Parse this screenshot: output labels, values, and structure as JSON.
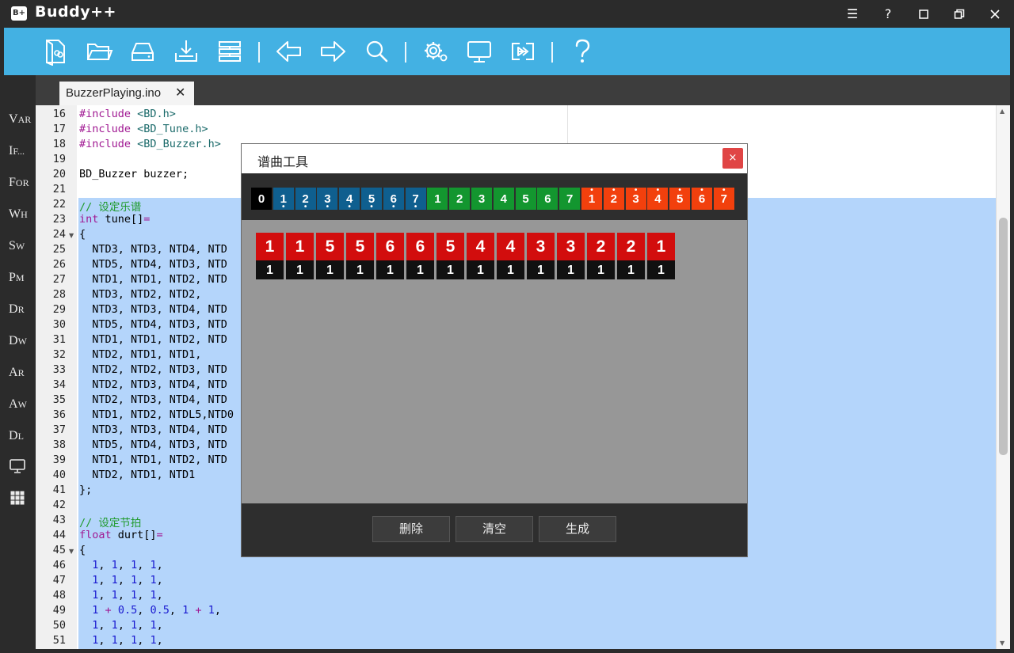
{
  "app": {
    "logo": "B+",
    "title": "Buddy++",
    "window_controls": [
      "☰",
      "?",
      "restore",
      "maximize",
      "close"
    ]
  },
  "toolbar": {
    "icons": [
      "new-file-icon",
      "open-folder-icon",
      "drive-icon",
      "download-icon",
      "stack-icon",
      "back-arrow-icon",
      "forward-arrow-icon",
      "search-icon",
      "settings-icon",
      "monitor-icon",
      "upload-icon",
      "help-icon"
    ]
  },
  "tabs": [
    {
      "label": "BuzzerPlaying.ino",
      "close": "✕"
    }
  ],
  "sidebar": {
    "items": [
      {
        "big": "V",
        "small": "AR"
      },
      {
        "big": "I",
        "small": "F..."
      },
      {
        "big": "F",
        "small": "OR"
      },
      {
        "big": "W",
        "small": "H"
      },
      {
        "big": "S",
        "small": "W"
      },
      {
        "big": "P",
        "small": "M"
      },
      {
        "big": "D",
        "small": "R"
      },
      {
        "big": "D",
        "small": "W"
      },
      {
        "big": "A",
        "small": "R"
      },
      {
        "big": "A",
        "small": "W"
      },
      {
        "big": "D",
        "small": "L"
      }
    ],
    "icons": [
      "monitor-icon",
      "grid-icon"
    ]
  },
  "editor": {
    "lines": [
      {
        "n": "16",
        "text": "#include <BD.h>"
      },
      {
        "n": "17",
        "text": "#include <BD_Tune.h>"
      },
      {
        "n": "18",
        "text": "#include <BD_Buzzer.h>"
      },
      {
        "n": "19",
        "text": ""
      },
      {
        "n": "20",
        "text": "BD_Buzzer buzzer;"
      },
      {
        "n": "21",
        "text": ""
      },
      {
        "n": "22",
        "text": "// 设定乐谱"
      },
      {
        "n": "23",
        "text": "int tune[]="
      },
      {
        "n": "24",
        "text": "{"
      },
      {
        "n": "25",
        "text": "  NTD3, NTD3, NTD4, NTD"
      },
      {
        "n": "26",
        "text": "  NTD5, NTD4, NTD3, NTD"
      },
      {
        "n": "27",
        "text": "  NTD1, NTD1, NTD2, NTD"
      },
      {
        "n": "28",
        "text": "  NTD3, NTD2, NTD2,"
      },
      {
        "n": "29",
        "text": "  NTD3, NTD3, NTD4, NTD"
      },
      {
        "n": "30",
        "text": "  NTD5, NTD4, NTD3, NTD"
      },
      {
        "n": "31",
        "text": "  NTD1, NTD1, NTD2, NTD"
      },
      {
        "n": "32",
        "text": "  NTD2, NTD1, NTD1,"
      },
      {
        "n": "33",
        "text": "  NTD2, NTD2, NTD3, NTD"
      },
      {
        "n": "34",
        "text": "  NTD2, NTD3, NTD4, NTD"
      },
      {
        "n": "35",
        "text": "  NTD2, NTD3, NTD4, NTD"
      },
      {
        "n": "36",
        "text": "  NTD1, NTD2, NTDL5,NTD0"
      },
      {
        "n": "37",
        "text": "  NTD3, NTD3, NTD4, NTD"
      },
      {
        "n": "38",
        "text": "  NTD5, NTD4, NTD3, NTD"
      },
      {
        "n": "39",
        "text": "  NTD1, NTD1, NTD2, NTD"
      },
      {
        "n": "40",
        "text": "  NTD2, NTD1, NTD1"
      },
      {
        "n": "41",
        "text": "};"
      },
      {
        "n": "42",
        "text": ""
      },
      {
        "n": "43",
        "text": "// 设定节拍"
      },
      {
        "n": "44",
        "text": "float durt[]="
      },
      {
        "n": "45",
        "text": "{"
      },
      {
        "n": "46",
        "text": "  1, 1, 1, 1,"
      },
      {
        "n": "47",
        "text": "  1, 1, 1, 1,"
      },
      {
        "n": "48",
        "text": "  1, 1, 1, 1,"
      },
      {
        "n": "49",
        "text": "  1 + 0.5, 0.5, 1 + 1,"
      },
      {
        "n": "50",
        "text": "  1, 1, 1, 1,"
      },
      {
        "n": "51",
        "text": "  1, 1, 1, 1,"
      }
    ]
  },
  "dialog": {
    "title": "谱曲工具",
    "close": "×",
    "palette": [
      {
        "digit": "0",
        "octave": "rest",
        "color": "#000000"
      },
      {
        "digit": "1",
        "octave": "low",
        "color": "#0f5f8f"
      },
      {
        "digit": "2",
        "octave": "low",
        "color": "#0f5f8f"
      },
      {
        "digit": "3",
        "octave": "low",
        "color": "#0f5f8f"
      },
      {
        "digit": "4",
        "octave": "low",
        "color": "#0f5f8f"
      },
      {
        "digit": "5",
        "octave": "low",
        "color": "#0f5f8f"
      },
      {
        "digit": "6",
        "octave": "low",
        "color": "#0f5f8f"
      },
      {
        "digit": "7",
        "octave": "low",
        "color": "#0f5f8f"
      },
      {
        "digit": "1",
        "octave": "mid",
        "color": "#13962f"
      },
      {
        "digit": "2",
        "octave": "mid",
        "color": "#13962f"
      },
      {
        "digit": "3",
        "octave": "mid",
        "color": "#13962f"
      },
      {
        "digit": "4",
        "octave": "mid",
        "color": "#13962f"
      },
      {
        "digit": "5",
        "octave": "mid",
        "color": "#13962f"
      },
      {
        "digit": "6",
        "octave": "mid",
        "color": "#13962f"
      },
      {
        "digit": "7",
        "octave": "mid",
        "color": "#13962f"
      },
      {
        "digit": "1",
        "octave": "high",
        "color": "#f2400d"
      },
      {
        "digit": "2",
        "octave": "high",
        "color": "#f2400d"
      },
      {
        "digit": "3",
        "octave": "high",
        "color": "#f2400d"
      },
      {
        "digit": "4",
        "octave": "high",
        "color": "#f2400d"
      },
      {
        "digit": "5",
        "octave": "high",
        "color": "#f2400d"
      },
      {
        "digit": "6",
        "octave": "high",
        "color": "#f2400d"
      },
      {
        "digit": "7",
        "octave": "high",
        "color": "#f2400d"
      }
    ],
    "notes": [
      {
        "pitch": "1",
        "beat": "1"
      },
      {
        "pitch": "1",
        "beat": "1"
      },
      {
        "pitch": "5",
        "beat": "1"
      },
      {
        "pitch": "5",
        "beat": "1"
      },
      {
        "pitch": "6",
        "beat": "1"
      },
      {
        "pitch": "6",
        "beat": "1"
      },
      {
        "pitch": "5",
        "beat": "1"
      },
      {
        "pitch": "4",
        "beat": "1"
      },
      {
        "pitch": "4",
        "beat": "1"
      },
      {
        "pitch": "3",
        "beat": "1"
      },
      {
        "pitch": "3",
        "beat": "1"
      },
      {
        "pitch": "2",
        "beat": "1"
      },
      {
        "pitch": "2",
        "beat": "1"
      },
      {
        "pitch": "1",
        "beat": "1"
      }
    ],
    "buttons": {
      "delete": "删除",
      "clear": "清空",
      "generate": "生成"
    }
  }
}
